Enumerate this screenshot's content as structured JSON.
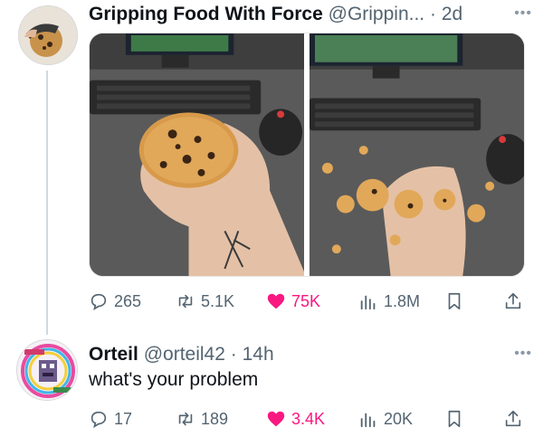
{
  "tweet": {
    "author_name": "Gripping Food With Force",
    "author_handle": "@Grippin...",
    "separator": "·",
    "time": "2d",
    "more_label": "•••",
    "stats": {
      "replies": "265",
      "retweets": "5.1K",
      "likes": "75K",
      "views": "1.8M"
    }
  },
  "reply": {
    "author_name": "Orteil",
    "author_handle": "@orteil42",
    "separator": "·",
    "time": "14h",
    "text": "what's your problem",
    "more_label": "•••",
    "stats": {
      "replies": "17",
      "retweets": "189",
      "likes": "3.4K",
      "views": "20K"
    }
  },
  "icons": {
    "reply": "speech-bubble-icon",
    "retweet": "retweet-icon",
    "like": "heart-icon",
    "views": "bar-chart-icon",
    "bookmark": "bookmark-icon",
    "share": "share-icon"
  },
  "colors": {
    "like": "#f91880",
    "muted": "#536471",
    "thread_line": "#cfd9de"
  }
}
